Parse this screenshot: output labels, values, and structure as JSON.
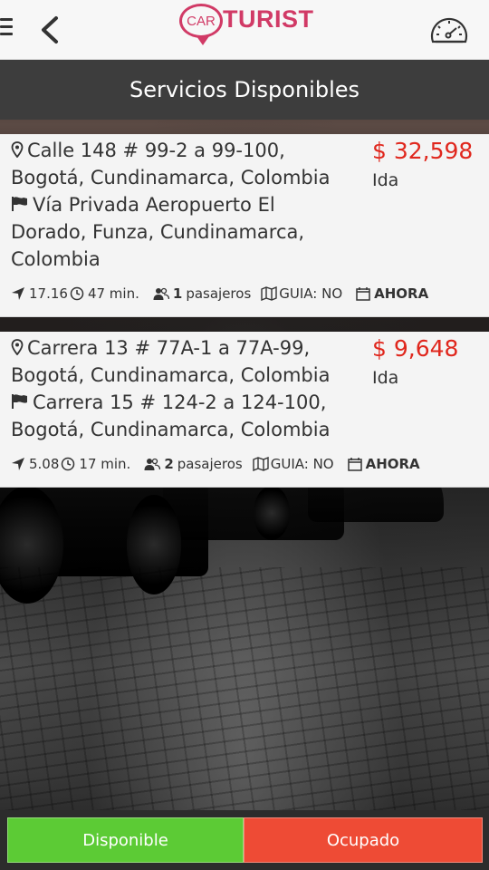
{
  "header": {
    "logo_car": "CAR",
    "logo_turist": "TURIST",
    "accent_color": "#d13a66"
  },
  "title": "Servicios Disponibles",
  "services": [
    {
      "origin_lines": [
        "Calle 148 # 99-2 a 99-100,",
        "Bogotá, Cundinamarca, Colombia"
      ],
      "destination_lines": [
        "Vía Privada Aeropuerto El",
        "Dorado, Funza, Cundinamarca,",
        "Colombia"
      ],
      "price": "$ 32,598",
      "trip_type": "Ida",
      "distance": "17.16",
      "duration": "47 min.",
      "passengers_count": "1",
      "passengers_label": "pasajeros",
      "guide": "GUIA: NO",
      "when": "AHORA"
    },
    {
      "origin_lines": [
        "Carrera 13 # 77A-1 a 77A-99,",
        "Bogotá, Cundinamarca, Colombia"
      ],
      "destination_lines": [
        "Carrera 15 # 124-2 a 124-100,",
        "Bogotá, Cundinamarca, Colombia"
      ],
      "price": "$ 9,648",
      "trip_type": "Ida",
      "distance": "5.08",
      "duration": "17 min.",
      "passengers_count": "2",
      "passengers_label": "pasajeros",
      "guide": "GUIA: NO",
      "when": "AHORA"
    }
  ],
  "buttons": {
    "available": "Disponible",
    "busy": "Ocupado"
  },
  "colors": {
    "price": "#e0271d",
    "available": "#5ccb35",
    "busy": "#ee4b35",
    "titlebar": "#3d3d3d"
  }
}
